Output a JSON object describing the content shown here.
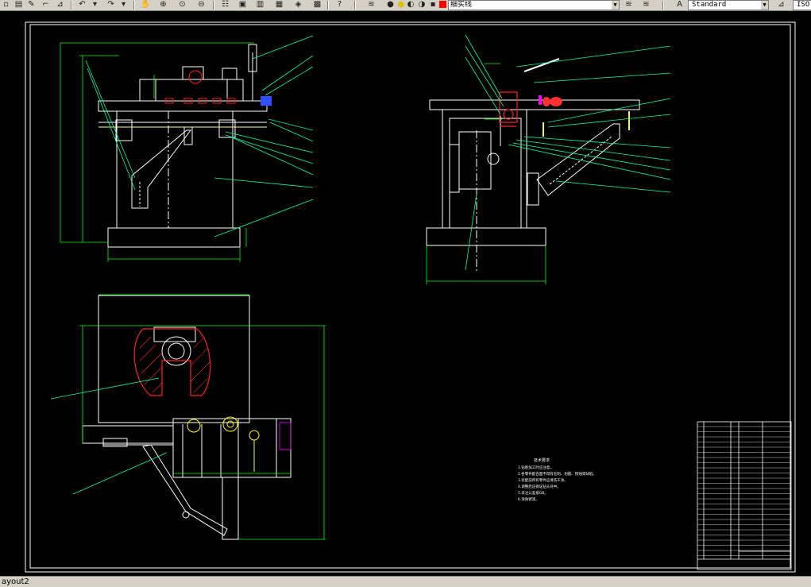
{
  "toolbar": {
    "layer_combo_value": "细实线",
    "textstyle_combo_value": "Standard",
    "dimstyle_combo_value": "ISO",
    "layer_color": "#ff0000",
    "icons": [
      "new-icon",
      "open-icon",
      "pencil-icon",
      "brush-icon",
      "undo-icon",
      "redo-icon",
      "pan-icon",
      "zoom-realtime-icon",
      "zoom-window-icon",
      "zoom-previous-icon",
      "properties-icon",
      "design-center-icon",
      "tool-palettes-icon",
      "sheet-set-icon",
      "markup-icon",
      "calculator-icon",
      "help-icon",
      "layer-manager-icon",
      "bulb-icon",
      "sun-icon",
      "lock-icon",
      "textstyle-icon",
      "layer-previous-icon",
      "dimstyle-icon"
    ]
  },
  "statusbar": {
    "layout_tab": "ayout2"
  },
  "drawing": {
    "notes_title": "技术要求",
    "notes_lines": [
      "1.钻削加工时应注意。",
      "2.各零件配合面不得有毛刺、划痕、锈蚀等缺陷。",
      "3.装配前所有零件应清洗干净。",
      "4.调整后应保证钻头对中。",
      "5.未注公差按GB。",
      "6.涂防锈漆。"
    ],
    "colors": {
      "outline": "#ffffff",
      "leader": "#00ffa0",
      "dimension": "#00ff00",
      "hatch": "#ff2020",
      "highlight": "#ffff00",
      "accent_blue": "#3050ff",
      "magenta": "#ff00ff"
    }
  }
}
